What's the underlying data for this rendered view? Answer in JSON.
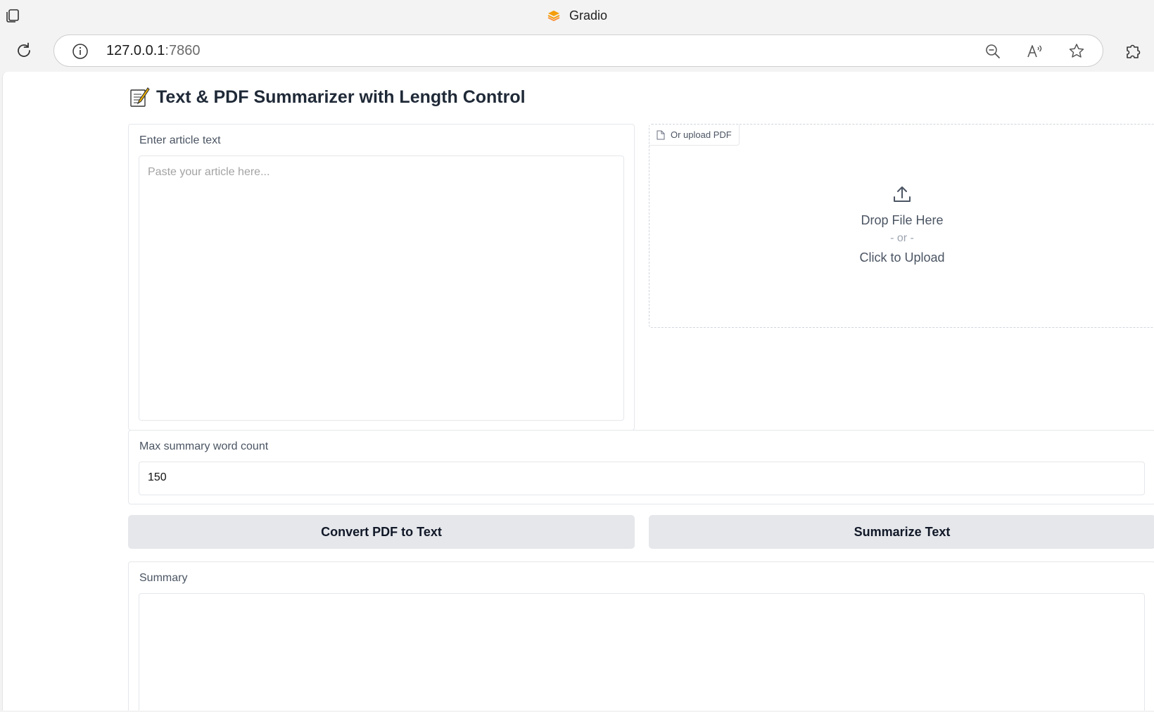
{
  "browser": {
    "tab_title": "Gradio",
    "url_host": "127.0.0.1",
    "url_port": ":7860"
  },
  "app": {
    "heading": "Text & PDF Summarizer with Length Control",
    "article": {
      "label": "Enter article text",
      "placeholder": "Paste your article here..."
    },
    "upload": {
      "chip_label": "Or upload PDF",
      "drop_text": "Drop File Here",
      "or_text": "- or -",
      "click_text": "Click to Upload"
    },
    "max_words": {
      "label": "Max summary word count",
      "value": "150"
    },
    "buttons": {
      "convert": "Convert PDF to Text",
      "summarize": "Summarize Text"
    },
    "summary": {
      "label": "Summary"
    }
  },
  "colors": {
    "button_bg": "#e5e7eb",
    "gradio_logo": "#f59e0b"
  }
}
